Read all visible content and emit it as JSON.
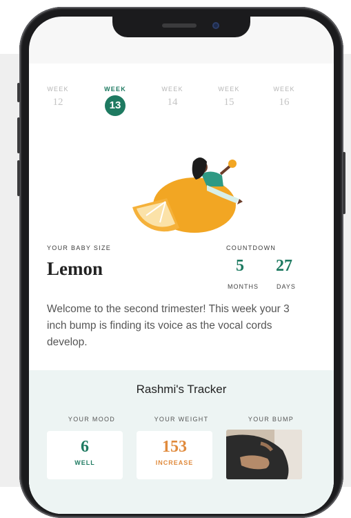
{
  "weeks": [
    {
      "label": "WEEK",
      "num": "12"
    },
    {
      "label": "WEEK",
      "num": "13"
    },
    {
      "label": "WEEK",
      "num": "14"
    },
    {
      "label": "WEEK",
      "num": "15"
    },
    {
      "label": "WEEK",
      "num": "16"
    }
  ],
  "active_week": "13",
  "baby": {
    "size_label": "YOUR BABY SIZE",
    "size_name": "Lemon"
  },
  "countdown": {
    "label": "COUNTDOWN",
    "months_value": "5",
    "months_unit": "MONTHS",
    "days_value": "27",
    "days_unit": "DAYS"
  },
  "description": "Welcome to the second trimester! This week your 3 inch bump is finding its voice as the vocal cords develop.",
  "tracker": {
    "title": "Rashmi's Tracker",
    "mood": {
      "label": "YOUR MOOD",
      "value": "6",
      "sub": "WELL"
    },
    "weight": {
      "label": "YOUR WEIGHT",
      "value": "153",
      "sub": "INCREASE"
    },
    "bump": {
      "label": "YOUR BUMP"
    }
  },
  "colors": {
    "accent_green": "#1e7a61",
    "weight_orange": "#e08a3c",
    "lemon": "#f2a623",
    "tracker_bg": "#edf4f3"
  },
  "icons": [
    "woman-on-lemon-illustration",
    "bump-photo"
  ]
}
